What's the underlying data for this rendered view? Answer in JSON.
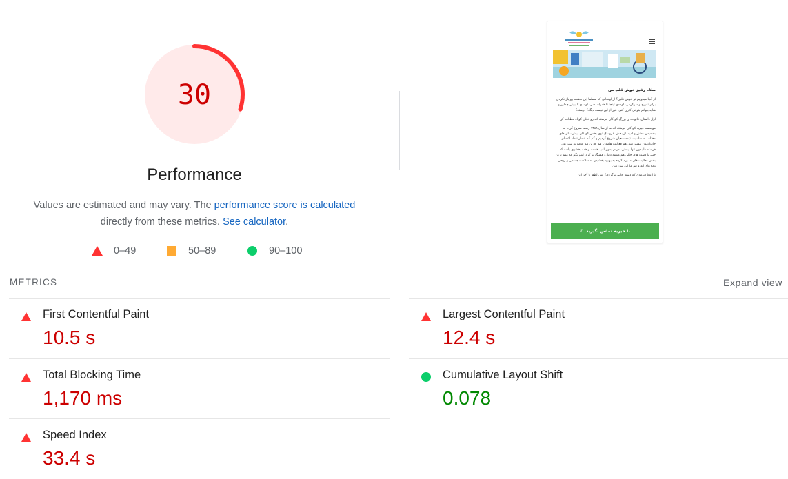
{
  "gauge": {
    "score": "30",
    "score_fraction": 0.3,
    "title": "Performance",
    "fail_color": "#ff3333",
    "fill_color": "#ffeaea"
  },
  "description": {
    "text_before": "Values are estimated and may vary. The ",
    "link1": "performance score is calculated",
    "text_middle": " directly from these metrics. ",
    "link2": "See calculator",
    "text_after": "."
  },
  "legend": [
    {
      "icon": "triangle",
      "label": "0–49",
      "color": "#ff3333"
    },
    {
      "icon": "square",
      "label": "50–89",
      "color": "#ffaa33"
    },
    {
      "icon": "circle",
      "label": "90–100",
      "color": "#0cce6b"
    }
  ],
  "thumbnail": {
    "heading": "سلام رفیق خوش قلب من",
    "paragraphs": [
      "از کجا میدونیم تو خوش قلبی؟ از اونجایی که مسلما این صفحه رو باز نکردی برای تفریح و سرگرمی، اومدی اینجا تا همراه نشی، اومدی تا ببینی چطور و شاید بتوانم بتوانی کاری کنی. غیر از این نیست دیگه؟ درسته؟",
      "اول داستان خانواده ی بزرگ کودکان فرشته اند رو خیلی کوتاه مطالعه کن",
      "موسسه خیریه کودکان فرشته اند ما از سال ۱۳۸۸ رسما شروع کرده به بخشیدن عشق و امید. از بخش عروسک توی بخش کودکان بیمارستان های مختلف به مناسبت تیمه شعبان شروع کردیم و کم کم شمار تعداد اعضای خانوادمون بیشتر شد. هم فعالیت هامون، هم افرین هم قدمه به سیر بود. فرشته ها بدون تنها نیستن، مردم بدون امید هست و همه بخشوی باشه که حتی با دست های خالی هم میشه دنیارو قشنگ تر کرد. ایتم بگم که مهم ترین بخش فعالیت های ما برمیگرده به بهبود بخشیدن به سلامت جسمی و روحی بچه های اند و تیم ما این سرزمین",
      "تا اینجا دیدمدی که دسته خالی برگردی؟ پس لطفا تا آخر این"
    ],
    "cta_label": "با خیریه تماس بگیرید"
  },
  "metrics": {
    "section_label": "METRICS",
    "expand_label": "Expand view",
    "items": [
      {
        "name": "first-contentful-paint",
        "title": "First Contentful Paint",
        "value": "10.5 s",
        "status": "fail"
      },
      {
        "name": "largest-contentful-paint",
        "title": "Largest Contentful Paint",
        "value": "12.4 s",
        "status": "fail"
      },
      {
        "name": "total-blocking-time",
        "title": "Total Blocking Time",
        "value": "1,170 ms",
        "status": "fail"
      },
      {
        "name": "cumulative-layout-shift",
        "title": "Cumulative Layout Shift",
        "value": "0.078",
        "status": "pass"
      },
      {
        "name": "speed-index",
        "title": "Speed Index",
        "value": "33.4 s",
        "status": "fail"
      }
    ]
  }
}
